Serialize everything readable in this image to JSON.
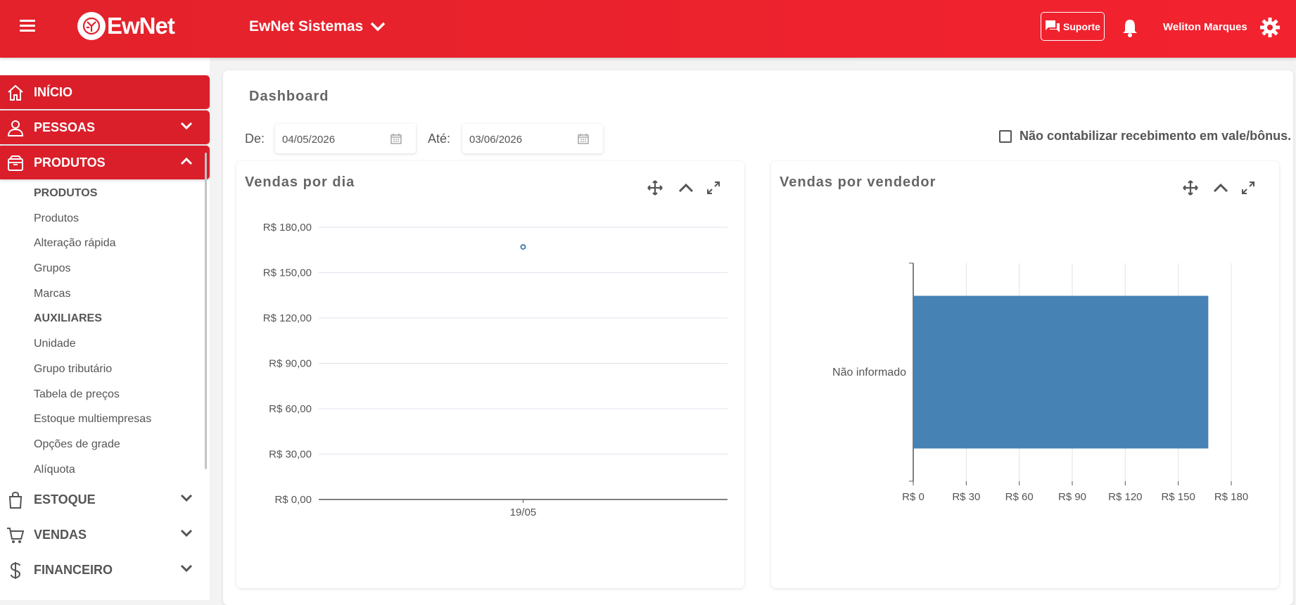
{
  "header": {
    "logo_text": "EwNet",
    "company": "EwNet Sistemas",
    "support_label": "Suporte",
    "user_name": "Weliton Marques"
  },
  "sidebar": {
    "main": [
      {
        "label": "INÍCIO",
        "icon": "home-icon"
      },
      {
        "label": "PESSOAS",
        "icon": "person-icon"
      },
      {
        "label": "PRODUTOS",
        "icon": "box-icon"
      }
    ],
    "sub_items": [
      {
        "label": "PRODUTOS",
        "header": true
      },
      {
        "label": "Produtos"
      },
      {
        "label": "Alteração rápida"
      },
      {
        "label": "Grupos"
      },
      {
        "label": "Marcas"
      },
      {
        "label": "AUXILIARES",
        "header": true
      },
      {
        "label": "Unidade"
      },
      {
        "label": "Grupo tributário"
      },
      {
        "label": "Tabela de preços"
      },
      {
        "label": "Estoque multiempresas"
      },
      {
        "label": "Opções de grade"
      },
      {
        "label": "Alíquota"
      }
    ],
    "bottom": [
      {
        "label": "ESTOQUE",
        "icon": "bag-icon"
      },
      {
        "label": "VENDAS",
        "icon": "cart-icon"
      },
      {
        "label": "FINANCEIRO",
        "icon": "dollar-icon"
      }
    ]
  },
  "dashboard": {
    "title": "Dashboard",
    "from_label": "De:",
    "from_value": "04/05/2026",
    "to_label": "Até:",
    "to_value": "03/06/2026",
    "checkbox_label": "Não contabilizar recebimento em vale/bônus.",
    "checkbox_checked": false
  },
  "panels": {
    "daily_title": "Vendas por dia",
    "seller_title": "Vendas por vendedor"
  },
  "chart_data": [
    {
      "type": "scatter",
      "title": "Vendas por dia",
      "x": [
        "19/05"
      ],
      "values": [
        167
      ],
      "ylim": [
        0,
        180
      ],
      "yticks": [
        0,
        30,
        60,
        90,
        120,
        150,
        180
      ],
      "ytick_labels": [
        "R$ 0,00",
        "R$ 30,00",
        "R$ 60,00",
        "R$ 90,00",
        "R$ 120,00",
        "R$ 150,00",
        "R$ 180,00"
      ],
      "grid": true,
      "color": "#4682b4"
    },
    {
      "type": "bar",
      "orientation": "horizontal",
      "title": "Vendas por vendedor",
      "categories": [
        "Não informado"
      ],
      "values": [
        167
      ],
      "xlim": [
        0,
        180
      ],
      "xticks": [
        0,
        30,
        60,
        90,
        120,
        150,
        180
      ],
      "xtick_labels": [
        "R$ 0",
        "R$ 30",
        "R$ 60",
        "R$ 90",
        "R$ 120",
        "R$ 150",
        "R$ 180"
      ],
      "grid": true,
      "color": "#4682b4"
    }
  ]
}
